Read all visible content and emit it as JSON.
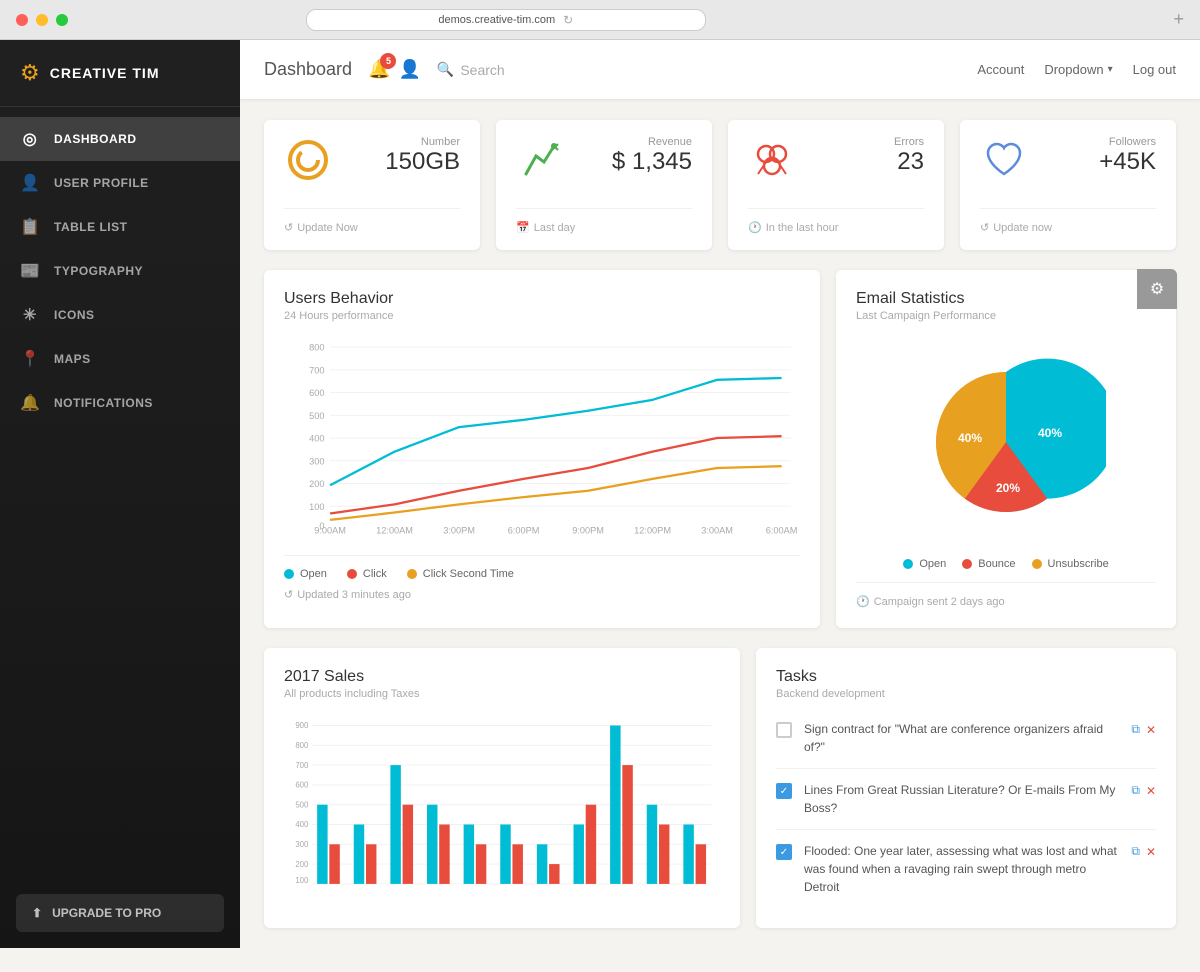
{
  "browser": {
    "url": "demos.creative-tim.com"
  },
  "sidebar": {
    "logo_icon": "⚙",
    "logo_text": "CREATIVE TIM",
    "nav_items": [
      {
        "id": "dashboard",
        "icon": "◎",
        "label": "DASHBOARD",
        "active": true
      },
      {
        "id": "user-profile",
        "icon": "👤",
        "label": "USER PROFILE",
        "active": false
      },
      {
        "id": "table-list",
        "icon": "📋",
        "label": "TABLE LIST",
        "active": false
      },
      {
        "id": "typography",
        "icon": "📰",
        "label": "TYPOGRAPHY",
        "active": false
      },
      {
        "id": "icons",
        "icon": "✳",
        "label": "ICONS",
        "active": false
      },
      {
        "id": "maps",
        "icon": "📍",
        "label": "MAPS",
        "active": false
      },
      {
        "id": "notifications",
        "icon": "🔔",
        "label": "NOTIFICATIONS",
        "active": false
      }
    ],
    "upgrade_icon": "⬆",
    "upgrade_label": "UPGRADE TO PRO"
  },
  "header": {
    "title": "Dashboard",
    "notification_badge": "5",
    "search_placeholder": "Search",
    "account_label": "Account",
    "dropdown_label": "Dropdown",
    "logout_label": "Log out"
  },
  "stats": [
    {
      "icon": "◎",
      "icon_color": "#e8a020",
      "label": "Number",
      "value": "150GB",
      "footer_icon": "↺",
      "footer_text": "Update Now"
    },
    {
      "icon": "🔦",
      "icon_color": "#4caf50",
      "label": "Revenue",
      "value": "$ 1,345",
      "footer_icon": "📅",
      "footer_text": "Last day"
    },
    {
      "icon": "⬡",
      "icon_color": "#e74c3c",
      "label": "Errors",
      "value": "23",
      "footer_icon": "🕐",
      "footer_text": "In the last hour"
    },
    {
      "icon": "♡",
      "icon_color": "#5b8cdb",
      "label": "Followers",
      "value": "+45K",
      "footer_icon": "↺",
      "footer_text": "Update now"
    }
  ],
  "users_behavior": {
    "title": "Users Behavior",
    "subtitle": "24 Hours performance",
    "updated_text": "Updated 3 minutes ago",
    "x_labels": [
      "9:00AM",
      "12:00AM",
      "3:00PM",
      "6:00PM",
      "9:00PM",
      "12:00PM",
      "3:00AM",
      "6:00AM"
    ],
    "y_labels": [
      "800",
      "700",
      "600",
      "500",
      "400",
      "300",
      "200",
      "100",
      "0"
    ],
    "series": [
      {
        "name": "Open",
        "color": "#00bcd4"
      },
      {
        "name": "Click",
        "color": "#e74c3c"
      },
      {
        "name": "Click Second Time",
        "color": "#e8a020"
      }
    ]
  },
  "email_stats": {
    "title": "Email Statistics",
    "subtitle": "Last Campaign Performance",
    "footer_text": "Campaign sent 2 days ago",
    "slices": [
      {
        "label": "Open",
        "percent": 40,
        "color": "#00bcd4"
      },
      {
        "label": "Bounce",
        "percent": 20,
        "color": "#e74c3c"
      },
      {
        "label": "Unsubscribe",
        "percent": 40,
        "color": "#e8a020"
      }
    ]
  },
  "sales_2017": {
    "title": "2017 Sales",
    "subtitle": "All products including Taxes",
    "colors": [
      "#00bcd4",
      "#e74c3c"
    ]
  },
  "tasks": {
    "title": "Tasks",
    "subtitle": "Backend development",
    "items": [
      {
        "checked": false,
        "text": "Sign contract for \"What are conference organizers afraid of?\""
      },
      {
        "checked": true,
        "text": "Lines From Great Russian Literature? Or E-mails From My Boss?"
      },
      {
        "checked": true,
        "text": "Flooded: One year later, assessing what was lost and what was found when a ravaging rain swept through metro Detroit"
      }
    ]
  }
}
